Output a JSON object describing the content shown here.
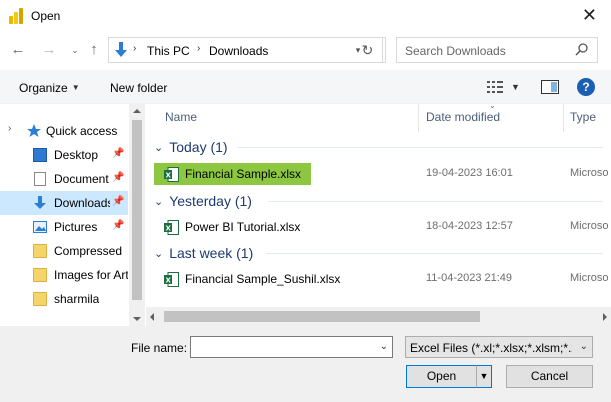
{
  "window": {
    "title": "Open"
  },
  "address_bar": {
    "crumbs": [
      "This PC",
      "Downloads"
    ],
    "search_placeholder": "Search Downloads"
  },
  "toolbar": {
    "organize_label": "Organize",
    "new_folder_label": "New folder"
  },
  "nav_pane": {
    "items": [
      {
        "label": "Quick access",
        "icon": "star-icon",
        "pinned": false
      },
      {
        "label": "Desktop",
        "icon": "desktop-icon",
        "pinned": true
      },
      {
        "label": "Document",
        "icon": "document-icon",
        "pinned": true
      },
      {
        "label": "Downloads",
        "icon": "download-icon",
        "pinned": true,
        "selected": true
      },
      {
        "label": "Pictures",
        "icon": "pictures-icon",
        "pinned": true
      },
      {
        "label": "Compressed I",
        "icon": "folder-icon",
        "pinned": false
      },
      {
        "label": "Images for Art",
        "icon": "folder-icon",
        "pinned": false
      },
      {
        "label": "sharmila",
        "icon": "folder-icon",
        "pinned": false
      }
    ]
  },
  "file_list": {
    "columns": {
      "name": "Name",
      "date": "Date modified",
      "type": "Type"
    },
    "groups": [
      {
        "label": "Today (1)",
        "files": [
          {
            "name": "Financial Sample.xlsx",
            "date": "19-04-2023 16:01",
            "type": "Microso",
            "selected": true
          }
        ]
      },
      {
        "label": "Yesterday (1)",
        "files": [
          {
            "name": "Power BI Tutorial.xlsx",
            "date": "18-04-2023 12:57",
            "type": "Microso"
          }
        ]
      },
      {
        "label": "Last week (1)",
        "files": [
          {
            "name": "Financial Sample_Sushil.xlsx",
            "date": "11-04-2023 21:49",
            "type": "Microso"
          }
        ]
      }
    ]
  },
  "bottom": {
    "file_name_label": "File name:",
    "file_name_value": "",
    "file_type": "Excel Files (*.xl;*.xlsx;*.xlsm;*.xl",
    "open_label": "Open",
    "cancel_label": "Cancel"
  },
  "colors": {
    "selection_highlight": "#8dc63f",
    "nav_selected": "#cce8ff",
    "group_header": "#1e3b70"
  }
}
